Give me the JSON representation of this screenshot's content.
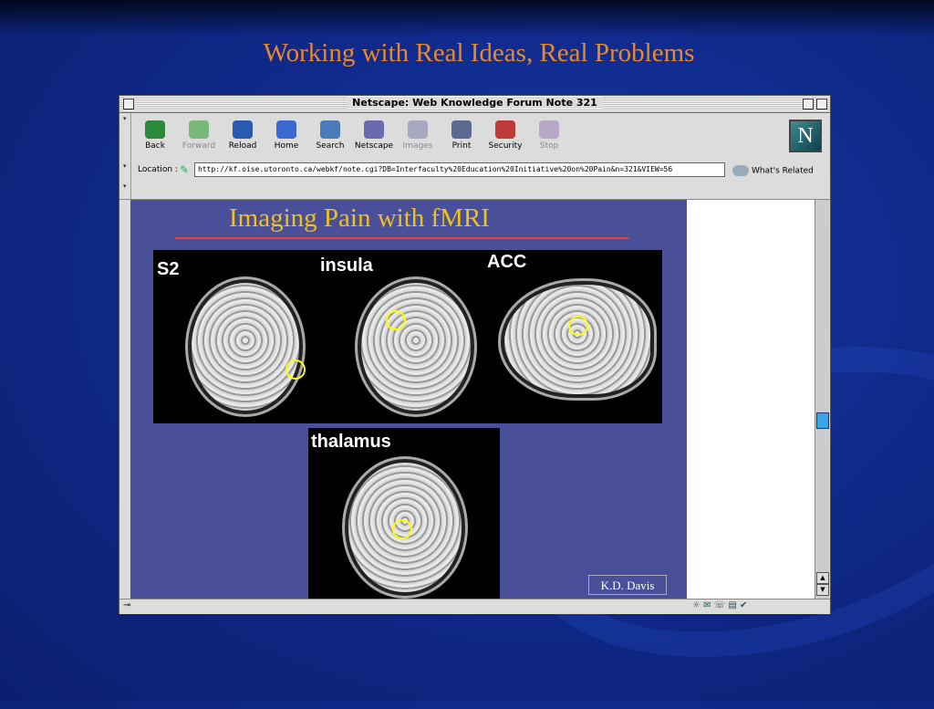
{
  "slide": {
    "title": "Working with Real Ideas, Real Problems"
  },
  "window": {
    "title": "Netscape: Web Knowledge Forum Note 321"
  },
  "toolbar": {
    "buttons": [
      {
        "label": "Back",
        "icon": "back-arrow-icon",
        "color": "#2a8a3a",
        "enabled": true
      },
      {
        "label": "Forward",
        "icon": "forward-arrow-icon",
        "color": "#7ab87a",
        "enabled": false
      },
      {
        "label": "Reload",
        "icon": "reload-icon",
        "color": "#2a5ab0",
        "enabled": true
      },
      {
        "label": "Home",
        "icon": "home-icon",
        "color": "#3a6ad0",
        "enabled": true
      },
      {
        "label": "Search",
        "icon": "search-icon",
        "color": "#4a7ab8",
        "enabled": true
      },
      {
        "label": "Netscape",
        "icon": "my-netscape-icon",
        "color": "#6a6ab0",
        "enabled": true
      },
      {
        "label": "Images",
        "icon": "images-icon",
        "color": "#a8a8c0",
        "enabled": false
      },
      {
        "label": "Print",
        "icon": "print-icon",
        "color": "#5a6a90",
        "enabled": true
      },
      {
        "label": "Security",
        "icon": "padlock-icon",
        "color": "#c03a3a",
        "enabled": true
      },
      {
        "label": "Stop",
        "icon": "stop-icon",
        "color": "#b8a8c8",
        "enabled": false
      }
    ],
    "logo": "N"
  },
  "location": {
    "label": "Location :",
    "url": "http://kf.oise.utoronto.ca/webkf/note.cgi?DB=Interfaculty%20Education%20Initiative%20on%20Pain&n=321&VIEW=56",
    "related": "What's Related"
  },
  "page": {
    "heading": "Imaging Pain with fMRI",
    "labels": {
      "s2": "S2",
      "insula": "insula",
      "acc": "ACC",
      "thalamus": "thalamus"
    },
    "credit": "K.D. Davis"
  }
}
